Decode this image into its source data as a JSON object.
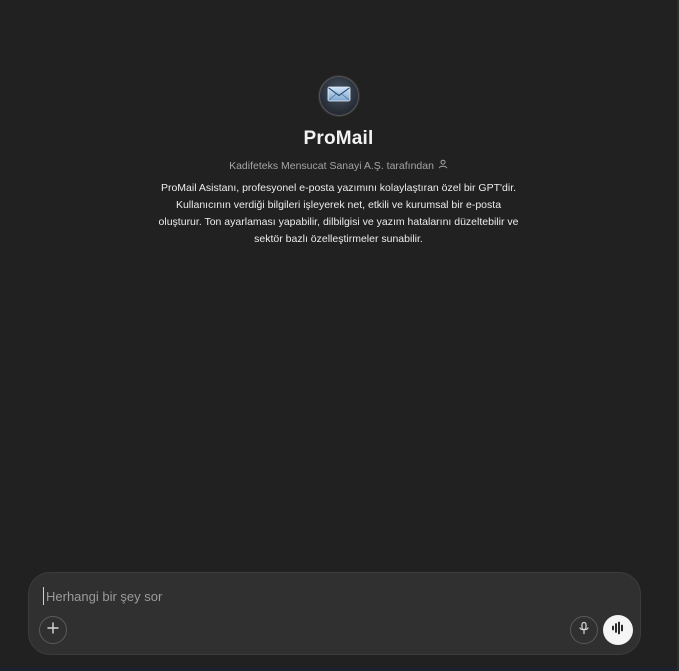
{
  "gpt": {
    "name": "ProMail",
    "author": "Kadifeteks Mensucat Sanayi A.Ş. tarafından",
    "description": "ProMail Asistanı, profesyonel e-posta yazımını kolaylaştıran özel bir GPT'dir. Kullanıcının verdiği bilgileri işleyerek net, etkili ve kurumsal bir e-posta oluşturur. Ton ayarlaması yapabilir, dilbilgisi ve yazım hatalarını düzeltebilir ve sektör bazlı özelleştirmeler sunabilir.",
    "avatar_icon": "envelope-icon",
    "author_icon": "person-icon"
  },
  "composer": {
    "placeholder": "Herhangi bir şey sor",
    "value": "",
    "add_icon": "plus-icon",
    "mic_icon": "microphone-icon",
    "voice_icon": "voice-waveform-icon"
  },
  "colors": {
    "background": "#212121",
    "composer_bg": "#303030",
    "text": "#ececec",
    "muted_text": "#a4a4a4",
    "voice_button_bg": "#f5f5f5"
  }
}
